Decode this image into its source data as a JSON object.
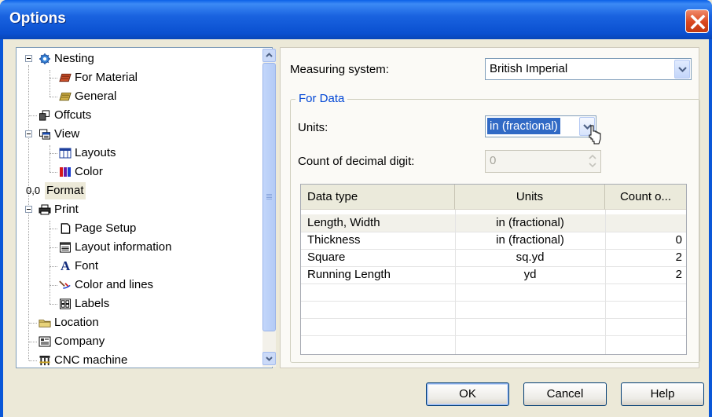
{
  "window": {
    "title": "Options",
    "close_icon": "close-icon"
  },
  "tree": {
    "items": [
      {
        "label": "Nesting",
        "icon": "nesting-gear-icon"
      },
      {
        "label": "For Material",
        "icon": "material-icon"
      },
      {
        "label": "General",
        "icon": "general-icon"
      },
      {
        "label": "Offcuts",
        "icon": "offcuts-icon"
      },
      {
        "label": "View",
        "icon": "view-icon"
      },
      {
        "label": "Layouts",
        "icon": "layouts-icon"
      },
      {
        "label": "Color",
        "icon": "color-icon"
      },
      {
        "label": "Format",
        "icon_text": "0,0"
      },
      {
        "label": "Print",
        "icon": "printer-icon"
      },
      {
        "label": "Page Setup",
        "icon": "page-setup-icon"
      },
      {
        "label": "Layout information",
        "icon": "layout-information-icon"
      },
      {
        "label": "Font",
        "icon_text": "A"
      },
      {
        "label": "Color and lines",
        "icon": "color-lines-icon"
      },
      {
        "label": "Labels",
        "icon": "labels-icon"
      },
      {
        "label": "Location",
        "icon": "folder-icon"
      },
      {
        "label": "Company",
        "icon": "company-icon"
      },
      {
        "label": "CNC machine",
        "icon": "cnc-machine-icon"
      }
    ],
    "selected": "Format"
  },
  "settings": {
    "measuring_label": "Measuring system:",
    "measuring_value": "British Imperial",
    "group_label": "For Data",
    "units_label": "Units:",
    "units_value": "in (fractional)",
    "decimal_label": "Count of decimal digit:",
    "decimal_value": "0"
  },
  "table": {
    "headers": [
      "Data type",
      "Units",
      "Count o..."
    ],
    "rows": [
      [
        "Length, Width",
        "in (fractional)",
        ""
      ],
      [
        "Thickness",
        "in (fractional)",
        "0"
      ],
      [
        "Square",
        "sq.yd",
        "2"
      ],
      [
        "Running Length",
        "yd",
        "2"
      ]
    ]
  },
  "buttons": {
    "ok": "OK",
    "cancel": "Cancel",
    "help": "Help"
  },
  "colors": {
    "titlebar": "#0a57d8",
    "accent": "#0046d5",
    "selection": "#316ac5"
  }
}
